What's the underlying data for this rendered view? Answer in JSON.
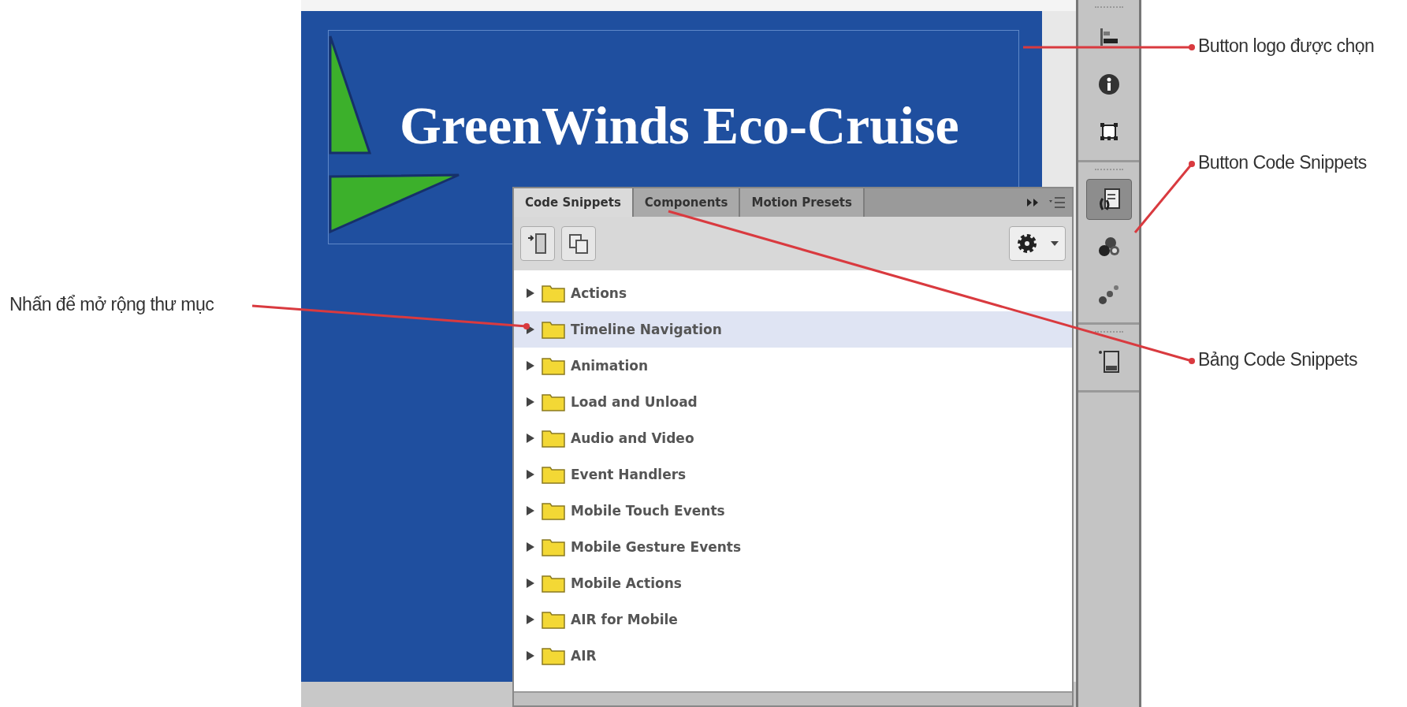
{
  "callouts": [
    {
      "text": "Button logo được chọn"
    },
    {
      "text": "Button Code Snippets"
    },
    {
      "text": "Bảng Code Snippets"
    },
    {
      "text": "Nhấn để mở rộng thư mục"
    }
  ],
  "stage": {
    "logo_text": "GreenWinds Eco-Cruise"
  },
  "panel": {
    "tabs": [
      {
        "label": "Code Snippets",
        "selected": true
      },
      {
        "label": "Components",
        "selected": false
      },
      {
        "label": "Motion Presets",
        "selected": false
      }
    ],
    "folders": [
      {
        "label": "Actions",
        "selected": false,
        "expanded": false
      },
      {
        "label": "Timeline Navigation",
        "selected": true,
        "expanded": false
      },
      {
        "label": "Animation",
        "selected": false,
        "expanded": false
      },
      {
        "label": "Load and Unload",
        "selected": false,
        "expanded": false
      },
      {
        "label": "Audio and Video",
        "selected": false,
        "expanded": false
      },
      {
        "label": "Event Handlers",
        "selected": false,
        "expanded": false
      },
      {
        "label": "Mobile Touch Events",
        "selected": false,
        "expanded": false
      },
      {
        "label": "Mobile Gesture Events",
        "selected": false,
        "expanded": false
      },
      {
        "label": "Mobile Actions",
        "selected": false,
        "expanded": false
      },
      {
        "label": "AIR for Mobile",
        "selected": false,
        "expanded": false
      },
      {
        "label": "AIR",
        "selected": false,
        "expanded": false
      }
    ]
  },
  "dock": {
    "groups": [
      [
        {
          "kind": "align",
          "selected": false
        },
        {
          "kind": "info",
          "selected": false
        },
        {
          "kind": "transform",
          "selected": false
        }
      ],
      [
        {
          "kind": "snippets",
          "selected": true
        },
        {
          "kind": "components",
          "selected": false
        },
        {
          "kind": "motion",
          "selected": false
        }
      ],
      [
        {
          "kind": "library",
          "selected": false
        }
      ]
    ]
  }
}
